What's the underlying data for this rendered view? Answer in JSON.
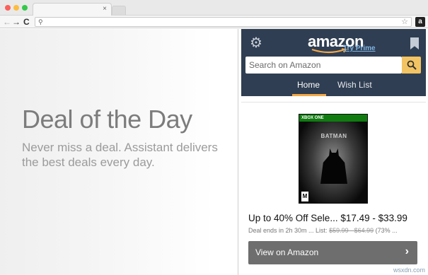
{
  "browser": {
    "tab_close": "×",
    "nav": {
      "back": "←",
      "forward": "→",
      "reload": "C"
    },
    "omnibox": {
      "search_glyph": "⚲",
      "star": "☆"
    },
    "extension_badge": "a"
  },
  "page": {
    "title": "Deal of the Day",
    "subtitle": "Never miss a deal. Assistant delivers the best deals every day."
  },
  "popup": {
    "logo": "amazon",
    "try_prime": "Try Prime",
    "search_placeholder": "Search on Amazon",
    "tabs": [
      {
        "label": "Home",
        "active": true
      },
      {
        "label": "Wish List",
        "active": false
      }
    ],
    "product": {
      "platform_band": "XBOX ONE",
      "game_title": "BATMAN",
      "rating": "M"
    },
    "deal": {
      "title": "Up to 40% Off Sele... $17.49 - $33.99",
      "ends": "Deal ends in 2h 30m ... List: ",
      "list_price": "$59.99 - $64.99",
      "percent": " (73% ..."
    },
    "view_button": "View on Amazon",
    "view_chevron": "›"
  },
  "watermark": "wsxdn.com",
  "colors": {
    "header_bg": "#2f3e52",
    "accent_orange": "#f3a847",
    "search_button": "#f3c463",
    "view_button": "#6e6e6e",
    "xbox_green": "#107c10"
  },
  "icons": [
    "gear-icon",
    "bookmark-icon",
    "search-icon",
    "chevron-right-icon",
    "star-icon"
  ]
}
